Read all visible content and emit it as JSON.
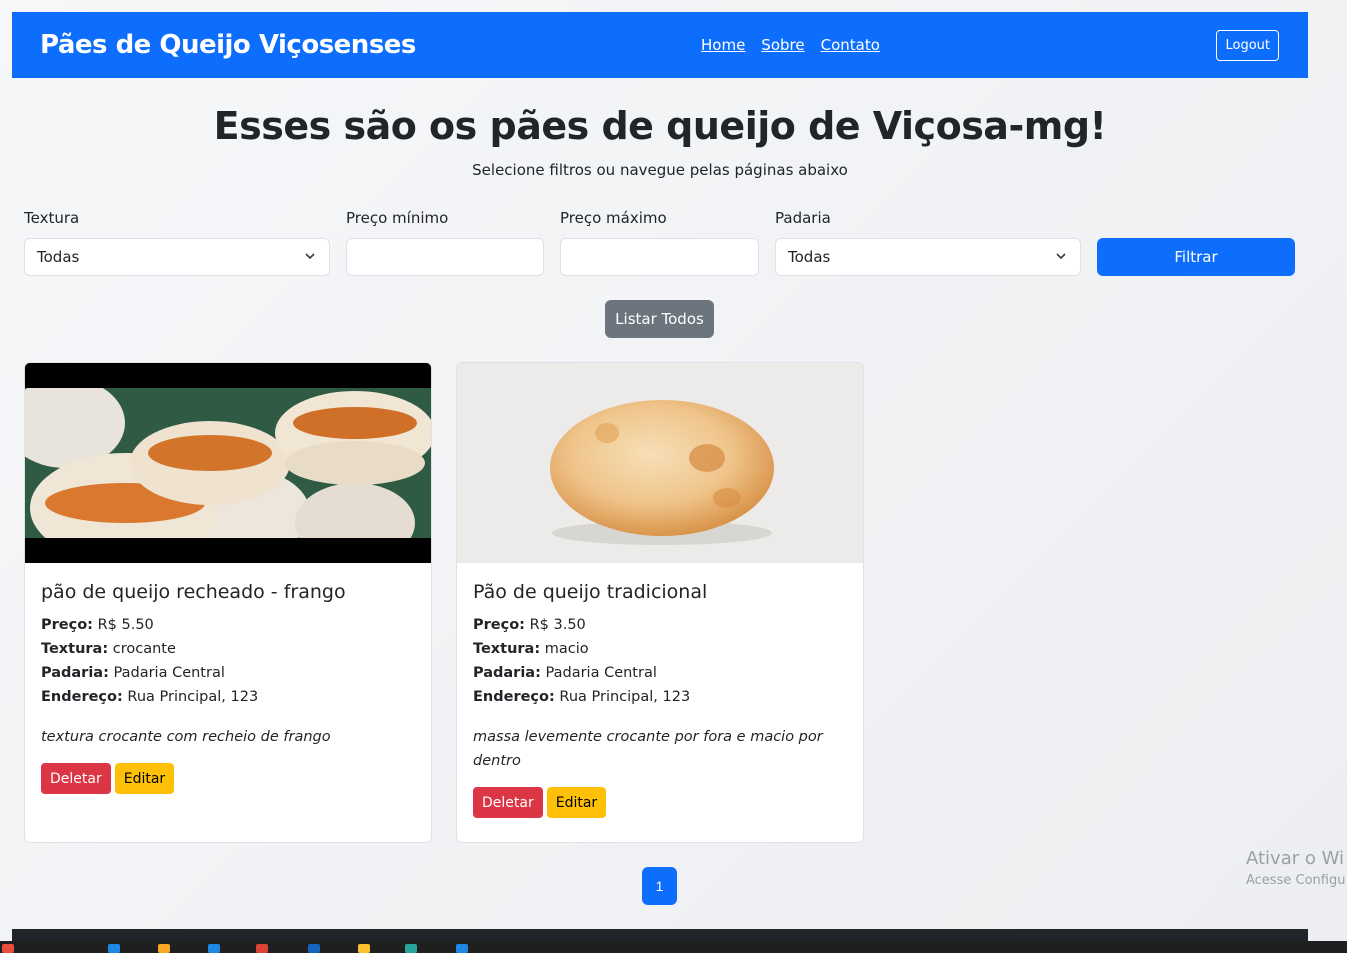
{
  "navbar": {
    "brand": "Pães de Queijo Viçosenses",
    "links": [
      "Home",
      "Sobre",
      "Contato"
    ],
    "logout": "Logout"
  },
  "header": {
    "title": "Esses são os pães de queijo de Viçosa-mg!",
    "subtitle": "Selecione filtros ou navegue pelas páginas abaixo"
  },
  "filters": {
    "texture_label": "Textura",
    "texture_value": "Todas",
    "min_price_label": "Preço mínimo",
    "min_price_value": "",
    "max_price_label": "Preço máximo",
    "max_price_value": "",
    "bakery_label": "Padaria",
    "bakery_value": "Todas",
    "filter_button": "Filtrar",
    "list_all_button": "Listar Todos"
  },
  "labels": {
    "price": "Preço:",
    "texture": "Textura:",
    "bakery": "Padaria:",
    "address": "Endereço:"
  },
  "cards": [
    {
      "title": "pão de queijo recheado - frango",
      "price": "R$ 5.50",
      "texture": "crocante",
      "bakery": "Padaria Central",
      "address": "Rua Principal, 123",
      "description": "textura crocante com recheio de frango",
      "delete": "Deletar",
      "edit": "Editar"
    },
    {
      "title": "Pão de queijo tradicional",
      "price": "R$ 3.50",
      "texture": "macio",
      "bakery": "Padaria Central",
      "address": "Rua Principal, 123",
      "description": "massa levemente crocante por fora e macio por dentro",
      "delete": "Deletar",
      "edit": "Editar"
    }
  ],
  "pagination": {
    "current": "1"
  },
  "watermark": {
    "line1": "Ativar o Wi",
    "line2": "Acesse Configu"
  },
  "colors": {
    "primary": "#0d6efd",
    "danger": "#dc3545",
    "warning": "#ffc107",
    "secondary": "#6c757d"
  }
}
